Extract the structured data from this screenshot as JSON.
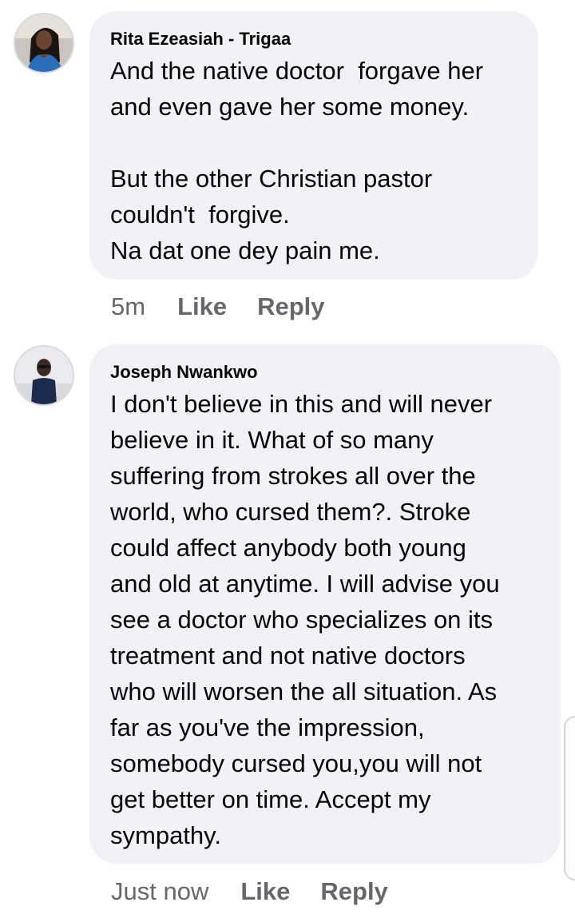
{
  "comments": [
    {
      "author": "Rita Ezeasiah - Trigaa",
      "text": "And the native doctor  forgave her\nand even gave her some money.\n\nBut the other Christian pastor\ncouldn't  forgive.\nNa dat one dey pain me.",
      "time": "5m",
      "like_label": "Like",
      "reply_label": "Reply"
    },
    {
      "author": "Joseph Nwankwo",
      "text": "I don't believe in this and will never\nbelieve in it. What of so many\nsuffering from strokes all over the\nworld, who cursed them?. Stroke\ncould affect anybody both young\nand old at anytime. I will advise you\nsee a doctor who specializes on its\ntreatment and not native doctors\nwho will worsen the all situation. As\nfar as you've the impression,\nsomebody cursed you,you will not\nget better on time. Accept my\nsympathy.",
      "time": "Just now",
      "like_label": "Like",
      "reply_label": "Reply"
    }
  ]
}
